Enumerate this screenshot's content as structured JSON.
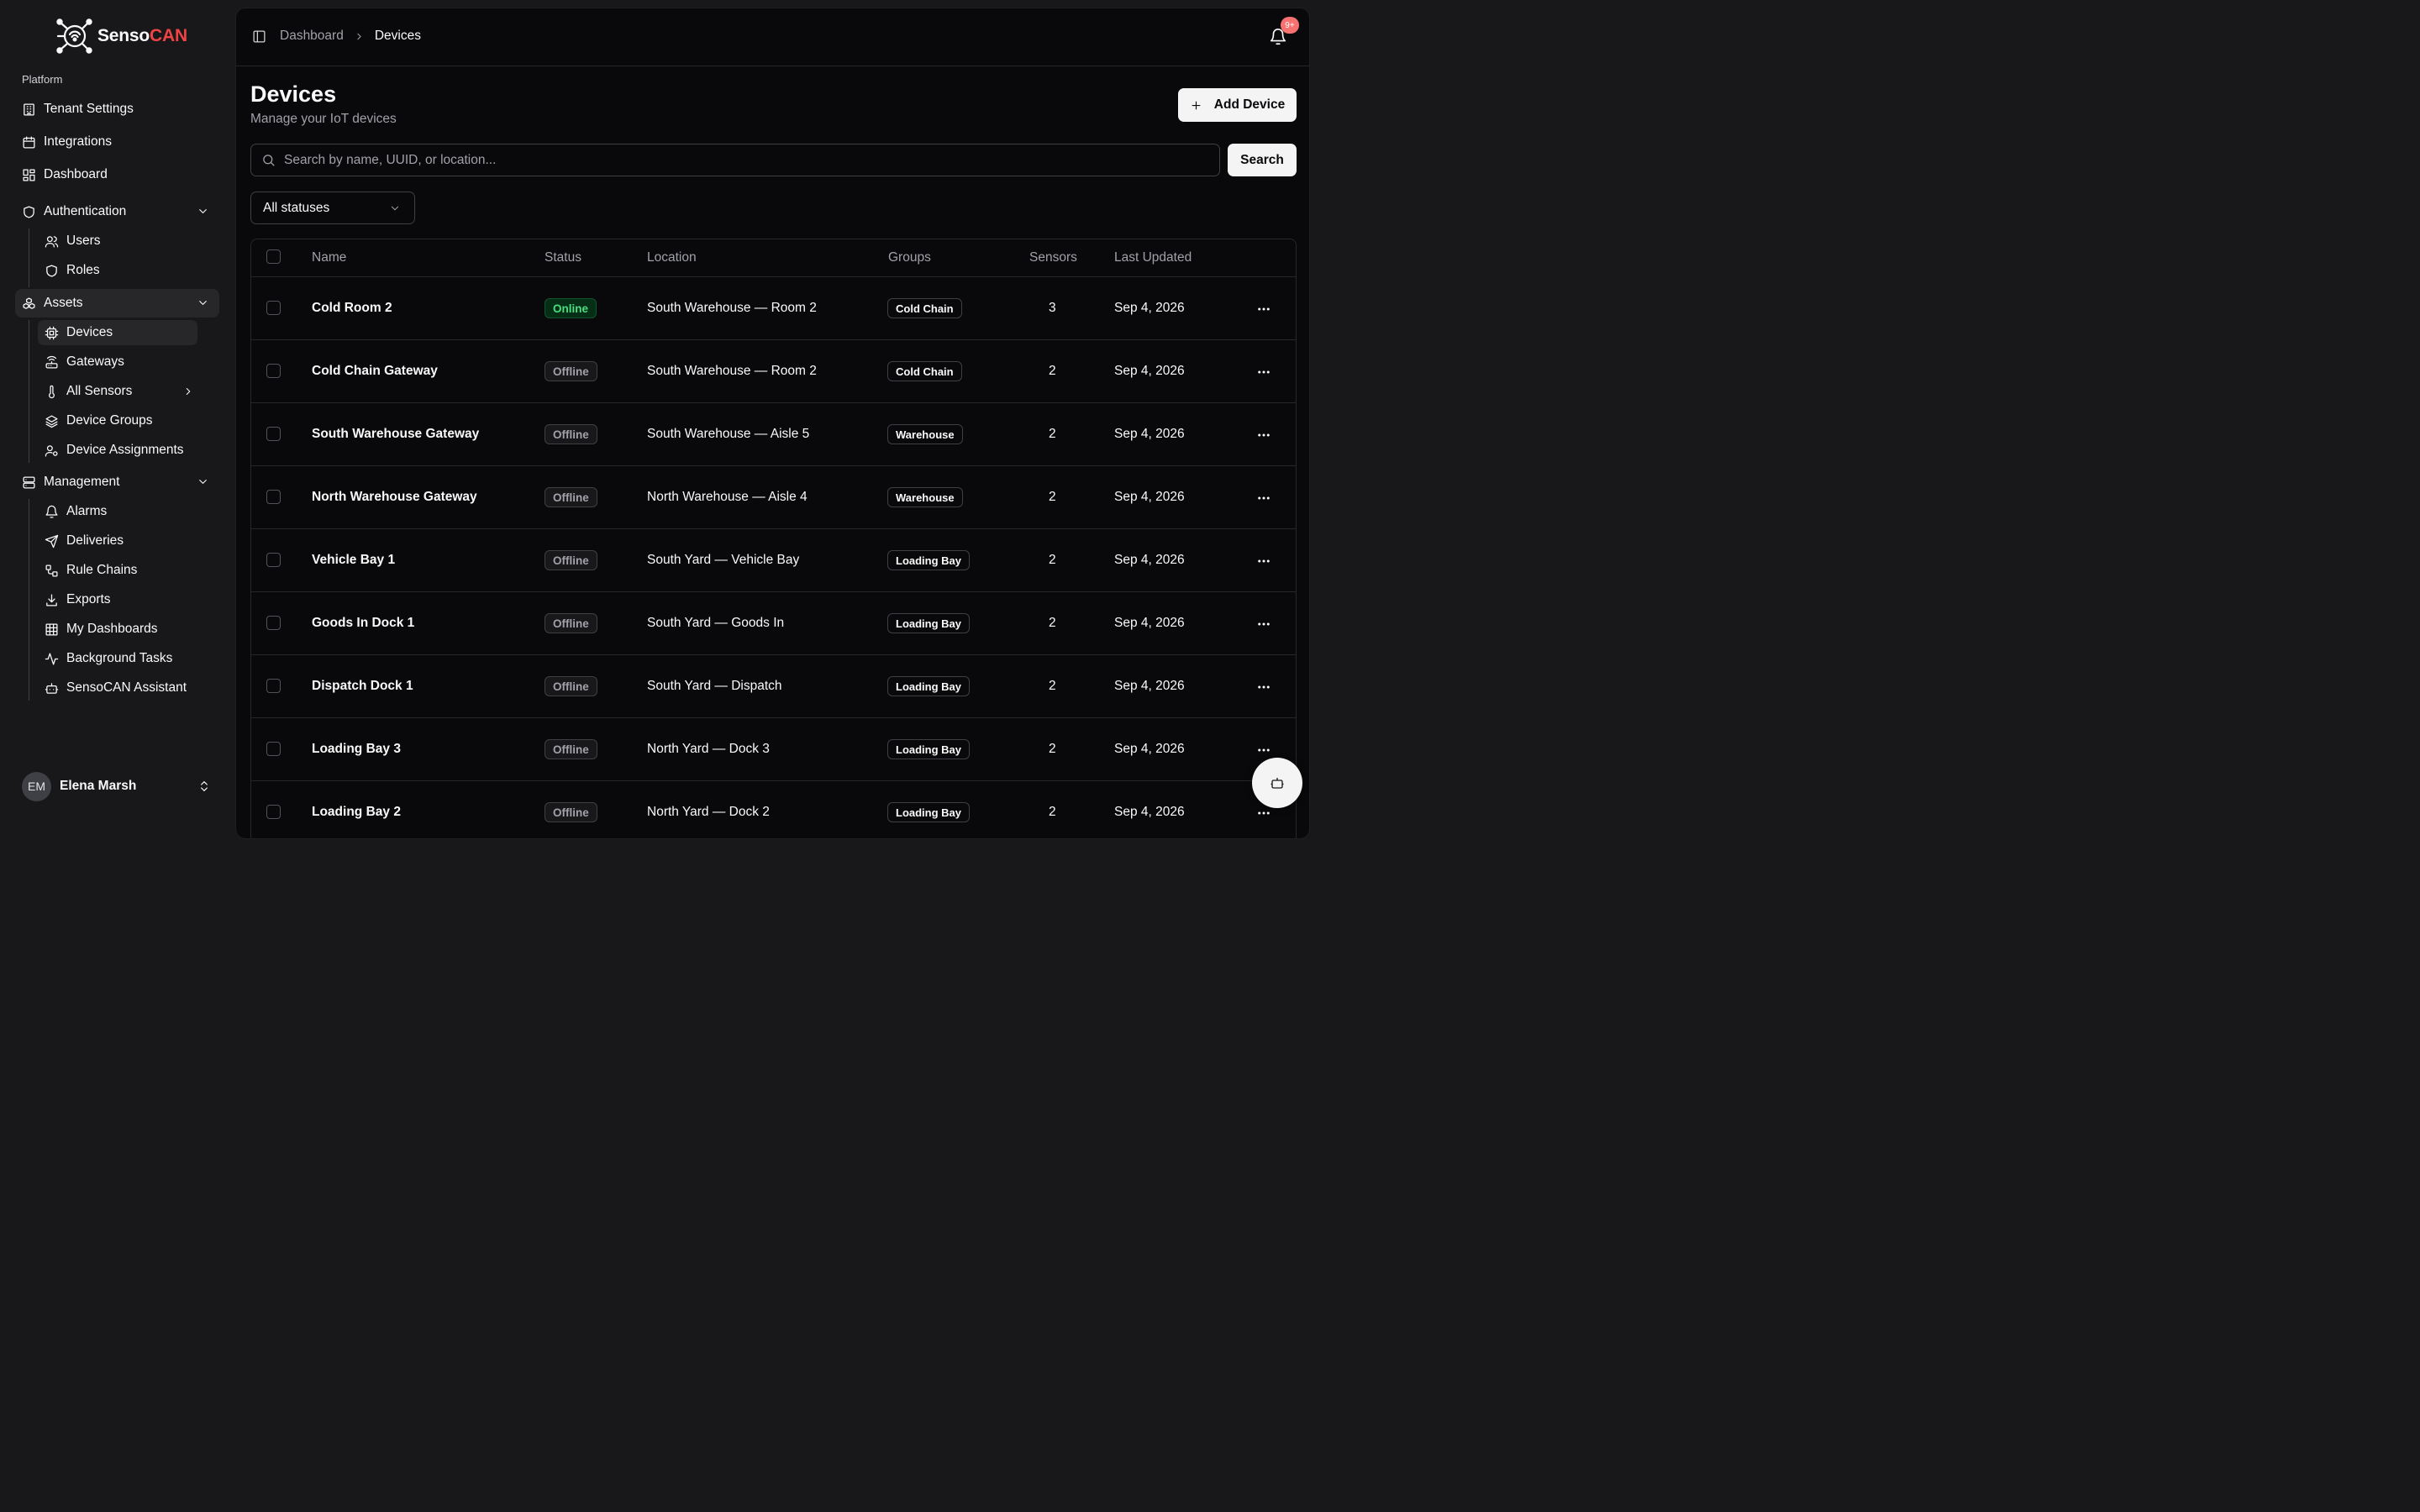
{
  "brand": {
    "name_part1": "Senso",
    "name_part2": "CAN",
    "accent_color": "#ef4444"
  },
  "sidebar": {
    "section_label": "Platform",
    "top_items": [
      {
        "label": "Tenant Settings",
        "icon": "building-icon"
      },
      {
        "label": "Integrations",
        "icon": "calendar-icon"
      },
      {
        "label": "Dashboard",
        "icon": "layout-grid-icon"
      }
    ],
    "authentication": {
      "label": "Authentication",
      "items": [
        {
          "label": "Users"
        },
        {
          "label": "Roles"
        }
      ]
    },
    "assets": {
      "label": "Assets",
      "items": [
        {
          "label": "Devices"
        },
        {
          "label": "Gateways"
        },
        {
          "label": "All Sensors"
        },
        {
          "label": "Device Groups"
        },
        {
          "label": "Device Assignments"
        }
      ]
    },
    "management": {
      "label": "Management",
      "items": [
        {
          "label": "Alarms"
        },
        {
          "label": "Deliveries"
        },
        {
          "label": "Rule Chains"
        },
        {
          "label": "Exports"
        },
        {
          "label": "My Dashboards"
        },
        {
          "label": "Background Tasks"
        },
        {
          "label": "SensoCAN Assistant"
        }
      ]
    },
    "user": {
      "initials": "EM",
      "name": "Elena Marsh"
    }
  },
  "header": {
    "breadcrumb": {
      "parent": "Dashboard",
      "current": "Devices"
    },
    "notifications_badge": "9+"
  },
  "page": {
    "title": "Devices",
    "subtitle": "Manage your IoT devices",
    "add_button": "Add Device",
    "search_placeholder": "Search by name, UUID, or location...",
    "search_button": "Search",
    "status_filter": "All statuses"
  },
  "table": {
    "columns": {
      "name": "Name",
      "status": "Status",
      "location": "Location",
      "groups": "Groups",
      "sensors": "Sensors",
      "last_updated": "Last Updated"
    },
    "rows": [
      {
        "name": "Cold Room 2",
        "status": "Online",
        "location": "South Warehouse — Room 2",
        "group": "Cold Chain",
        "sensors": "3",
        "updated": "Sep 4, 2026"
      },
      {
        "name": "Cold Chain Gateway",
        "status": "Offline",
        "location": "South Warehouse — Room 2",
        "group": "Cold Chain",
        "sensors": "2",
        "updated": "Sep 4, 2026"
      },
      {
        "name": "South Warehouse Gateway",
        "status": "Offline",
        "location": "South Warehouse — Aisle 5",
        "group": "Warehouse",
        "sensors": "2",
        "updated": "Sep 4, 2026"
      },
      {
        "name": "North Warehouse Gateway",
        "status": "Offline",
        "location": "North Warehouse — Aisle 4",
        "group": "Warehouse",
        "sensors": "2",
        "updated": "Sep 4, 2026"
      },
      {
        "name": "Vehicle Bay 1",
        "status": "Offline",
        "location": "South Yard — Vehicle Bay",
        "group": "Loading Bay",
        "sensors": "2",
        "updated": "Sep 4, 2026"
      },
      {
        "name": "Goods In Dock 1",
        "status": "Offline",
        "location": "South Yard — Goods In",
        "group": "Loading Bay",
        "sensors": "2",
        "updated": "Sep 4, 2026"
      },
      {
        "name": "Dispatch Dock 1",
        "status": "Offline",
        "location": "South Yard — Dispatch",
        "group": "Loading Bay",
        "sensors": "2",
        "updated": "Sep 4, 2026"
      },
      {
        "name": "Loading Bay 3",
        "status": "Offline",
        "location": "North Yard — Dock 3",
        "group": "Loading Bay",
        "sensors": "2",
        "updated": "Sep 4, 2026"
      },
      {
        "name": "Loading Bay 2",
        "status": "Offline",
        "location": "North Yard — Dock 2",
        "group": "Loading Bay",
        "sensors": "2",
        "updated": "Sep 4, 2026"
      }
    ]
  },
  "colors": {
    "online": "#4ade80",
    "background": "#09090b",
    "sidebar": "#18181b",
    "badge": "#f87171"
  }
}
